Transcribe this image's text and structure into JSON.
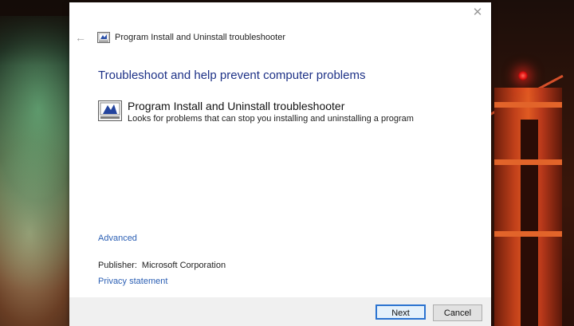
{
  "window": {
    "title": "Program Install and Uninstall troubleshooter",
    "close_glyph": "✕",
    "back_glyph": "←",
    "back_icon": "back-arrow-icon",
    "app_icon": "troubleshooter-icon"
  },
  "main": {
    "heading": "Troubleshoot and help prevent computer problems",
    "tool": {
      "name": "Program Install and Uninstall troubleshooter",
      "description": "Looks for problems that can stop you installing and uninstalling a program",
      "icon": "troubleshooter-icon"
    },
    "advanced_link": "Advanced",
    "publisher_label": "Publisher:",
    "publisher_value": "Microsoft Corporation",
    "privacy_link": "Privacy statement"
  },
  "footer": {
    "next_label": "Next",
    "cancel_label": "Cancel"
  },
  "colors": {
    "heading": "#1e3287",
    "link": "#2b5fb4",
    "default_button_border": "#2b73d0"
  }
}
